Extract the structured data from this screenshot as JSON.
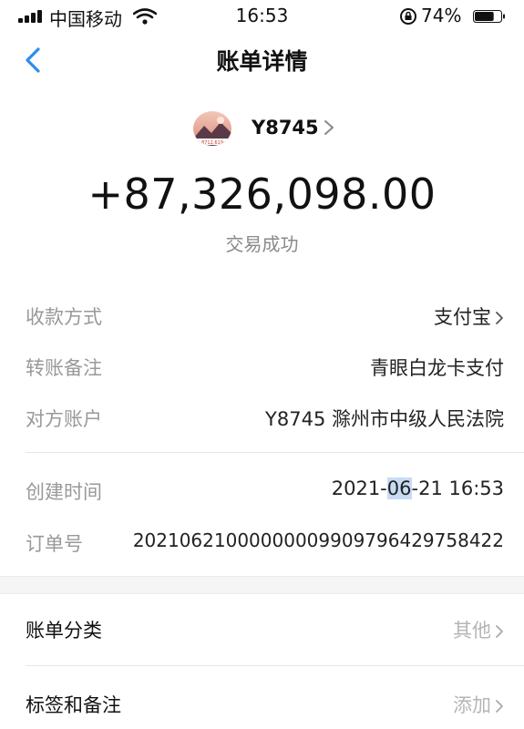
{
  "status_bar": {
    "carrier": "中国移动",
    "time": "16:53",
    "battery_percent": "74%",
    "battery_level": 0.74
  },
  "nav": {
    "back_icon": "chevron-left-icon",
    "title": "账单详情"
  },
  "payee": {
    "name": "Y8745",
    "avatar_text": "8712.619"
  },
  "amount": "+87,326,098.00",
  "transaction_status": "交易成功",
  "details": [
    {
      "label": "收款方式",
      "value": "支付宝"
    },
    {
      "label": "转账备注",
      "value": "青眼白龙卡支付"
    },
    {
      "label": "对方账户",
      "value": "Y8745 滁州市中级人民法院"
    }
  ],
  "meta": {
    "created_label": "创建时间",
    "created_pre": "2021-",
    "created_highlight": "06",
    "created_post": "-21 16:53",
    "order_label": "订单号",
    "order_value": "20210621000000009909796429758422"
  },
  "actions": [
    {
      "label": "账单分类",
      "value": "其他"
    },
    {
      "label": "标签和备注",
      "value": "添加"
    }
  ],
  "colors": {
    "accent": "#2d8cf0",
    "muted_text": "#999999",
    "highlight": "#c7dcf3"
  }
}
